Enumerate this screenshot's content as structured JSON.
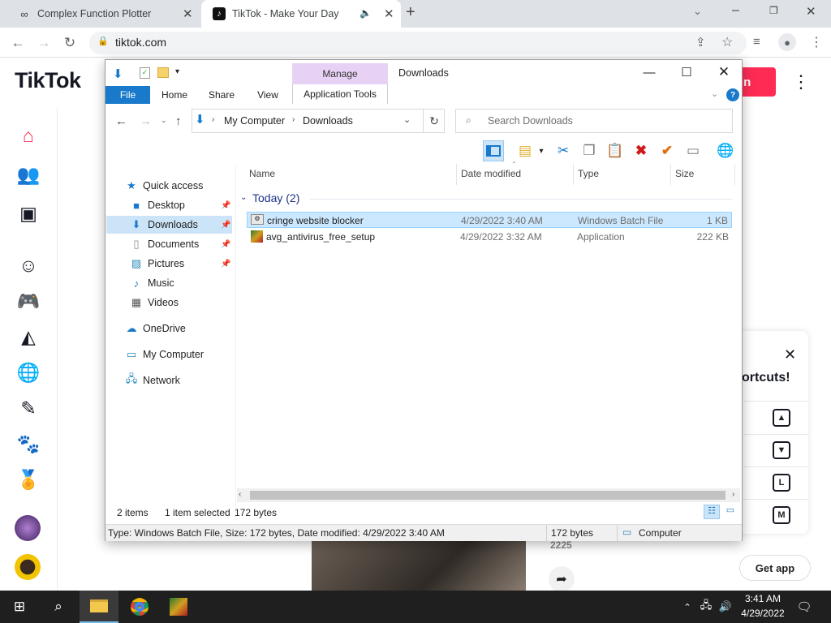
{
  "browser": {
    "tabs": [
      {
        "title": "Complex Function Plotter",
        "icon": "infinity-icon"
      },
      {
        "title": "TikTok - Make Your Day",
        "icon": "tiktok-icon"
      }
    ],
    "url": "tiktok.com"
  },
  "page": {
    "logo": "TikTok",
    "login_label": "in",
    "shortcuts_title": "ortcuts!",
    "shortcut_keys": [
      "▲",
      "▼",
      "L",
      "M"
    ],
    "get_app": "Get app",
    "count_partial": "2225",
    "colors": {
      "brand": "#fe2c55"
    }
  },
  "explorer": {
    "title": "Downloads",
    "ribbon": {
      "file": "File",
      "home": "Home",
      "share": "Share",
      "view": "View",
      "manage": "Manage",
      "app_tools": "Application Tools"
    },
    "path": [
      "My Computer",
      "Downloads"
    ],
    "search_placeholder": "Search Downloads",
    "nav": {
      "quick_access": "Quick access",
      "items": [
        {
          "label": "Desktop",
          "pinned": true
        },
        {
          "label": "Downloads",
          "pinned": true,
          "selected": true
        },
        {
          "label": "Documents",
          "pinned": true
        },
        {
          "label": "Pictures",
          "pinned": true
        },
        {
          "label": "Music"
        },
        {
          "label": "Videos"
        }
      ],
      "onedrive": "OneDrive",
      "computer": "My Computer",
      "network": "Network"
    },
    "columns": {
      "name": "Name",
      "date": "Date modified",
      "type": "Type",
      "size": "Size"
    },
    "group": "Today (2)",
    "files": [
      {
        "name": "cringe website blocker",
        "date": "4/29/2022 3:40 AM",
        "type": "Windows Batch File",
        "size": "1 KB",
        "selected": true
      },
      {
        "name": "avg_antivirus_free_setup",
        "date": "4/29/2022 3:32 AM",
        "type": "Application",
        "size": "222 KB"
      }
    ],
    "status": {
      "items": "2 items",
      "selected": "1 item selected",
      "size": "172 bytes"
    },
    "details": {
      "text": "Type: Windows Batch File, Size: 172 bytes, Date modified: 4/29/2022 3:40 AM",
      "size": "172 bytes",
      "location": "Computer"
    }
  },
  "taskbar": {
    "time": "3:41 AM",
    "date": "4/29/2022"
  }
}
